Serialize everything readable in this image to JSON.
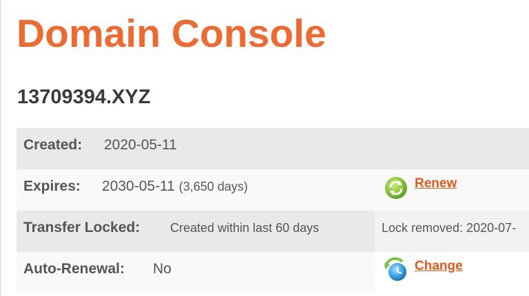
{
  "header": {
    "title": "Domain Console",
    "domain_name": "13709394.XYZ"
  },
  "details": {
    "created": {
      "label": "Created:",
      "value": "2020-05-11"
    },
    "expires": {
      "label": "Expires:",
      "value": "2030-05-11",
      "days": "(3,650 days)",
      "action_label": "Renew",
      "action_icon": "renew-icon"
    },
    "transfer_locked": {
      "label": "Transfer Locked:",
      "value": "Created within last 60 days",
      "note": "Lock removed: 2020-07-"
    },
    "auto_renewal": {
      "label": "Auto-Renewal:",
      "value": "No",
      "action_label": "Change",
      "action_icon": "clock-change-icon"
    }
  },
  "colors": {
    "accent": "#ee6a30",
    "link": "#e05a1c",
    "row_shaded": "#e9e9e9",
    "row_light": "#f9f9f9"
  }
}
